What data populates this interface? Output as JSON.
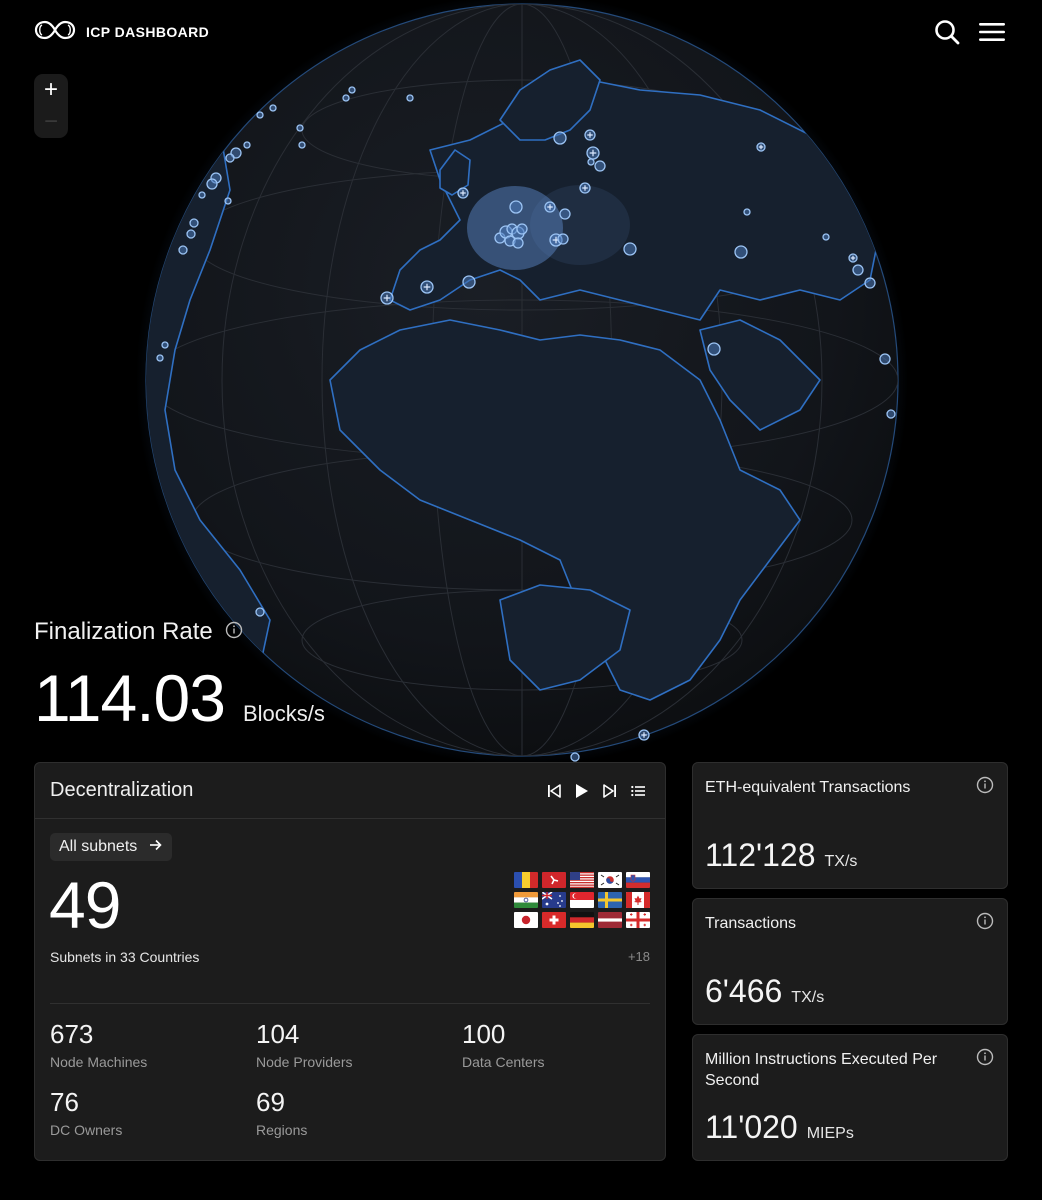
{
  "header": {
    "brand": "ICP DASHBOARD",
    "icons": [
      "infinity-logo-icon",
      "search-icon",
      "menu-icon"
    ]
  },
  "map_controls": {
    "zoom_in": "+",
    "zoom_out": "−"
  },
  "finalization": {
    "title": "Finalization Rate",
    "value": "114.03",
    "unit": "Blocks/s"
  },
  "decentralization": {
    "title": "Decentralization",
    "controls": [
      "skip-back-icon",
      "play-icon",
      "skip-forward-icon",
      "list-icon"
    ],
    "filter_label": "All subnets",
    "subnet_count": "49",
    "subnet_caption": "Subnets in 33 Countries",
    "more_countries": "+18",
    "flags": [
      "romania",
      "isle-of-man",
      "usa",
      "south-korea",
      "slovenia",
      "india",
      "australia",
      "singapore",
      "sweden",
      "canada",
      "japan",
      "switzerland",
      "germany",
      "latvia",
      "georgia"
    ],
    "stats": [
      {
        "value": "673",
        "label": "Node Machines"
      },
      {
        "value": "104",
        "label": "Node Providers"
      },
      {
        "value": "100",
        "label": "Data Centers"
      },
      {
        "value": "76",
        "label": "DC Owners"
      },
      {
        "value": "69",
        "label": "Regions"
      }
    ]
  },
  "metrics": [
    {
      "title": "ETH-equivalent Transactions",
      "value": "112'128",
      "unit": "TX/s"
    },
    {
      "title": "Transactions",
      "value": "6'466",
      "unit": "TX/s"
    },
    {
      "title": "Million Instructions Executed Per Second",
      "value": "11'020",
      "unit": "MIEPs"
    }
  ],
  "colors": {
    "background": "#000000",
    "globe": "#13171d",
    "land_outline": "#2f6fc2",
    "node": "#7fb0ee",
    "panel": "#1c1c1c"
  }
}
